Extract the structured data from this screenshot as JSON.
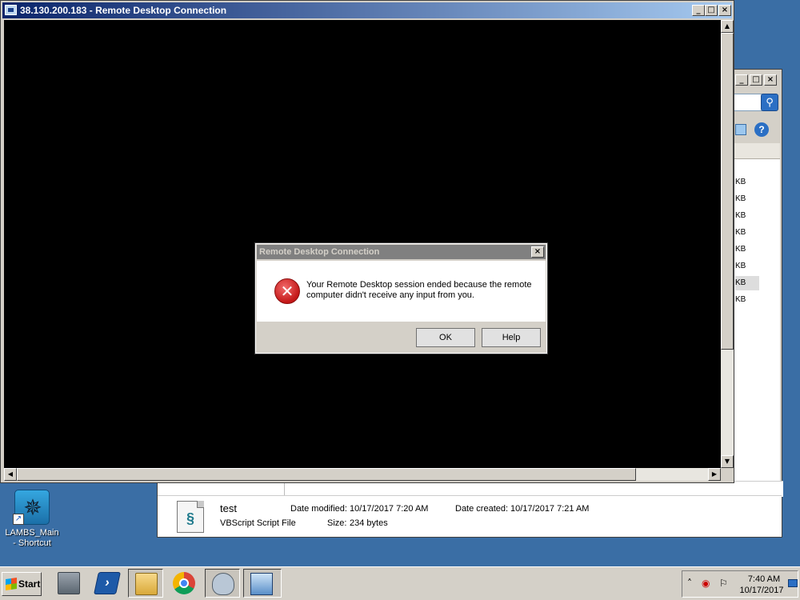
{
  "rdp_window": {
    "title": "38.130.200.183 - Remote Desktop Connection",
    "minimize": "_",
    "maximize": "□",
    "close": "×"
  },
  "dialog": {
    "title": "Remote Desktop Connection",
    "close": "×",
    "icon": "error-icon",
    "message": "Your Remote Desktop session ended because the remote computer didn't receive any input from you.",
    "ok_label": "OK",
    "help_label": "Help"
  },
  "explorer": {
    "minimize": "_",
    "maximize": "□",
    "close": "×",
    "size_suffix": [
      "KB",
      "KB",
      "KB",
      "KB",
      "KB",
      "KB",
      "KB",
      "KB"
    ],
    "details": {
      "name": "test",
      "type": "VBScript Script File",
      "date_modified_label": "Date modified:",
      "date_modified": "10/17/2017 7:20 AM",
      "date_created_label": "Date created:",
      "date_created": "10/17/2017 7:21 AM",
      "size_label": "Size:",
      "size": "234 bytes"
    }
  },
  "desktop": {
    "icon_label": "LAMBS_Main - Shortcut"
  },
  "taskbar": {
    "start_label": "Start",
    "clock_time": "7:40 AM",
    "clock_date": "10/17/2017",
    "apps": [
      "server-manager-icon",
      "powershell-icon",
      "file-explorer-icon",
      "chrome-icon",
      "mouse-app-icon",
      "remote-desktop-icon"
    ]
  }
}
